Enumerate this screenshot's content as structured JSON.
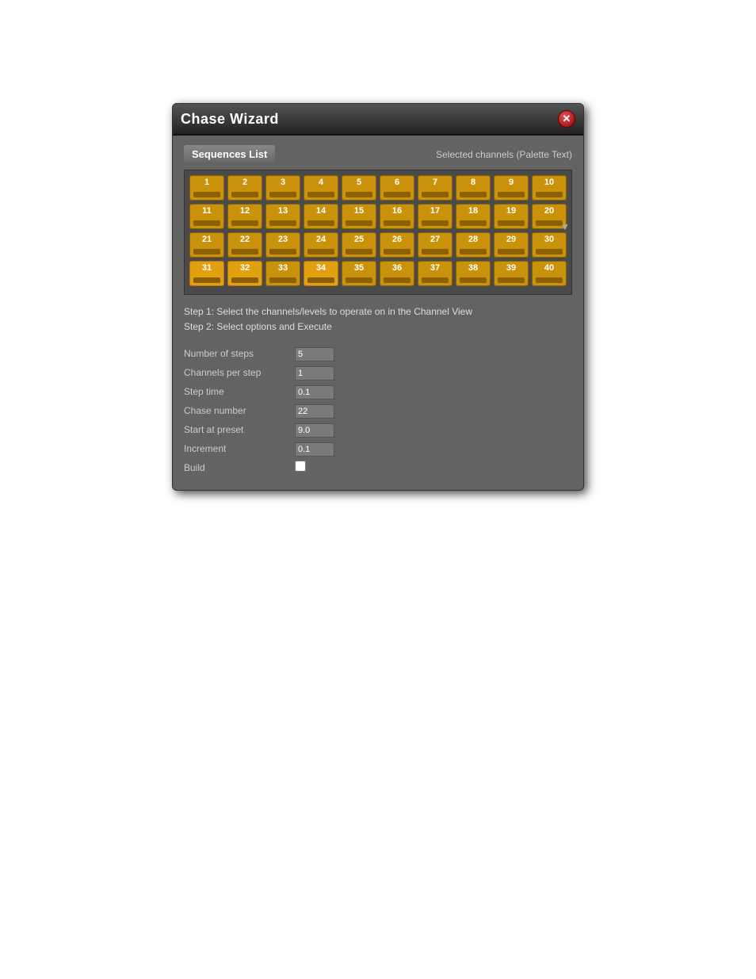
{
  "dialog": {
    "title": "Chase Wizard",
    "close_label": "✕"
  },
  "sequences": {
    "label": "Sequences List",
    "palette_text": "Selected channels (Palette Text)",
    "rows": [
      [
        1,
        2,
        3,
        4,
        5,
        6,
        7,
        8,
        9,
        10
      ],
      [
        11,
        12,
        13,
        14,
        15,
        16,
        17,
        18,
        19,
        20
      ],
      [
        21,
        22,
        23,
        24,
        25,
        26,
        27,
        28,
        29,
        30
      ],
      [
        31,
        32,
        33,
        34,
        35,
        36,
        37,
        38,
        39,
        40
      ]
    ],
    "highlighted": [
      31,
      32,
      34
    ]
  },
  "instructions": {
    "step1": "Step 1: Select the channels/levels to operate on in the Channel View",
    "step2": "Step 2: Select options and Execute"
  },
  "fields": [
    {
      "label": "Number of steps",
      "value": "5",
      "type": "input",
      "name": "number-of-steps"
    },
    {
      "label": "Channels per step",
      "value": "1",
      "type": "input",
      "name": "channels-per-step"
    },
    {
      "label": "Step time",
      "value": "0.1",
      "type": "input",
      "name": "step-time"
    },
    {
      "label": "Chase number",
      "value": "22",
      "type": "input",
      "name": "chase-number"
    },
    {
      "label": "Start at preset",
      "value": "9.0",
      "type": "input",
      "name": "start-at-preset"
    },
    {
      "label": "Increment",
      "value": "0.1",
      "type": "input",
      "name": "increment"
    },
    {
      "label": "Build",
      "value": "",
      "type": "checkbox",
      "name": "build"
    }
  ]
}
